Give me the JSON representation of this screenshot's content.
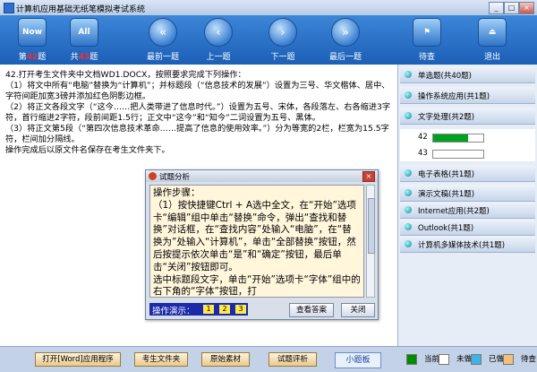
{
  "app": {
    "title": "计算机应用基础无纸笔模拟考试系统"
  },
  "window": {
    "minimize": "_",
    "maximize": "□",
    "close": "×"
  },
  "toolbar": {
    "current_pre": "第",
    "current_num": "42",
    "current_post": "题",
    "total_pre": "共",
    "total_num": "43",
    "total_post": "题",
    "first": "最前一题",
    "prev": "上一题",
    "next": "下一题",
    "last": "最后一题",
    "wait": "待查",
    "exit": "退出",
    "now_icon_text": "Now",
    "all_icon_text": "All"
  },
  "question": {
    "lines": [
      "42.打开考生文件夹中文档WD1.DOCX，按照要求完成下列操作：",
      "  （1）将文中所有“电脑”替换为“计算机”；并标题段（“信息技术的发展”）设置为三号、华文楷体、居中、字符间距加宽3磅并添加红色阴影边框。",
      "  （2）将正文各段文字（“这今……把人类带进了信息时代。”）设置为五号、宋体，各段落左、右各缩进3字符，首行缩进2字符，段前间距1.5行；正文中“这今”和“知今”二词设置为五号、黑体。",
      "  （3）将正文第5段（“第四次信息技术革命……提高了信息的使用效率。”）分为等宽的2栏，栏宽为15.5字符，栏间加分隔线。",
      "操作完成后以原文件名保存在考生文件夹下。"
    ]
  },
  "sidebar": {
    "items": [
      {
        "label": "单选题(共40题)"
      },
      {
        "label": "操作系统应用(共1题)"
      },
      {
        "label": "文字处理(共2题)"
      },
      {
        "label": "电子表格(共1题)"
      },
      {
        "label": "演示文稿(共1题)"
      },
      {
        "label": "Internet应用(共2题)"
      },
      {
        "label": "Outlook(共1题)"
      },
      {
        "label": "计算机多媒体技术(共1题)"
      }
    ],
    "questions": [
      {
        "num": "42",
        "progress": 0.7
      },
      {
        "num": "43",
        "progress": 0
      }
    ]
  },
  "dialog": {
    "title": "试题分析",
    "close": "×",
    "content": [
      "操作步骤：",
      "（1）按快捷键Ctrl + A选中全文，在“开始”选项卡“编辑”组中单击“替换”命令，弹出“查找和替换”对话框，在“查找内容”处输入“电脑”，在“替换为”处输入“计算机”，单击“全部替换”按钮，然后按提示依次单击“是”和“确定”按钮，最后单击“关闭”按钮即可。",
      "    选中标题段文字，单击“开始”选项卡“字体”组中的右下角的“字体”按钮，打"
    ],
    "demo_label": "操作演示：",
    "demo_steps": [
      "1",
      "2",
      "3"
    ],
    "view_answer": "查看答案",
    "close_button": "关闭"
  },
  "bottom": {
    "open_app": "打开[Word]应用程序",
    "student_folder": "考生文件夹",
    "original_material": "原始素材",
    "analysis": "试题评析",
    "small_board": "小题板"
  },
  "legend": [
    {
      "label": "当前",
      "color": "#008a00"
    },
    {
      "label": "未做",
      "color": "#ffffff"
    },
    {
      "label": "已做",
      "color": "#3fb2e6"
    },
    {
      "label": "待查",
      "color": "#f2c07a"
    }
  ]
}
